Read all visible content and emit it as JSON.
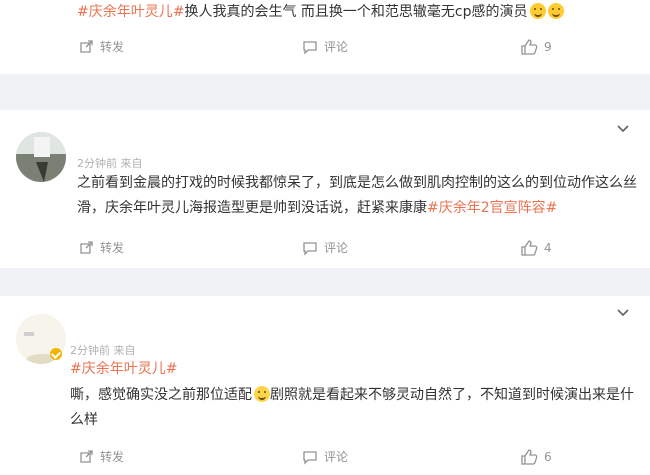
{
  "post1": {
    "hashtag": "#庆余年叶灵儿#",
    "text": "换人我真的会生气 而且换一个和范思辙毫无cp感的演员",
    "emoji": [
      "smile-icon",
      "smile-icon"
    ],
    "actions": {
      "repost": "转发",
      "comment": "评论",
      "like_count": "9"
    }
  },
  "post2": {
    "meta": "2分钟前 来自",
    "text_part1": "之前看到金晨的打戏的时候我都惊呆了，到底是怎么做到肌肉控制的这么的到位动作这么丝滑，庆余年叶灵儿海报造型更是帅到没话说，赶紧来康康",
    "hashtag": "#庆余年2官宣阵容#",
    "actions": {
      "repost": "转发",
      "comment": "评论",
      "like_count": "4"
    }
  },
  "post3": {
    "meta": "2分钟前  来自",
    "hashtag": "#庆余年叶灵儿#",
    "text_part1": "嘶，感觉确实没之前那位适配",
    "text_part2": "剧照就是看起来不够灵动自然了，不知道到时候演出来是什么样",
    "emoji": "sweat-smile-icon",
    "actions": {
      "repost": "转发",
      "comment": "评论",
      "like_count": "6"
    }
  },
  "colors": {
    "hashtag": "#eb7350",
    "text": "#333333",
    "muted": "#939393",
    "separator": "#f1f2f5",
    "verified": "#f5b400"
  }
}
